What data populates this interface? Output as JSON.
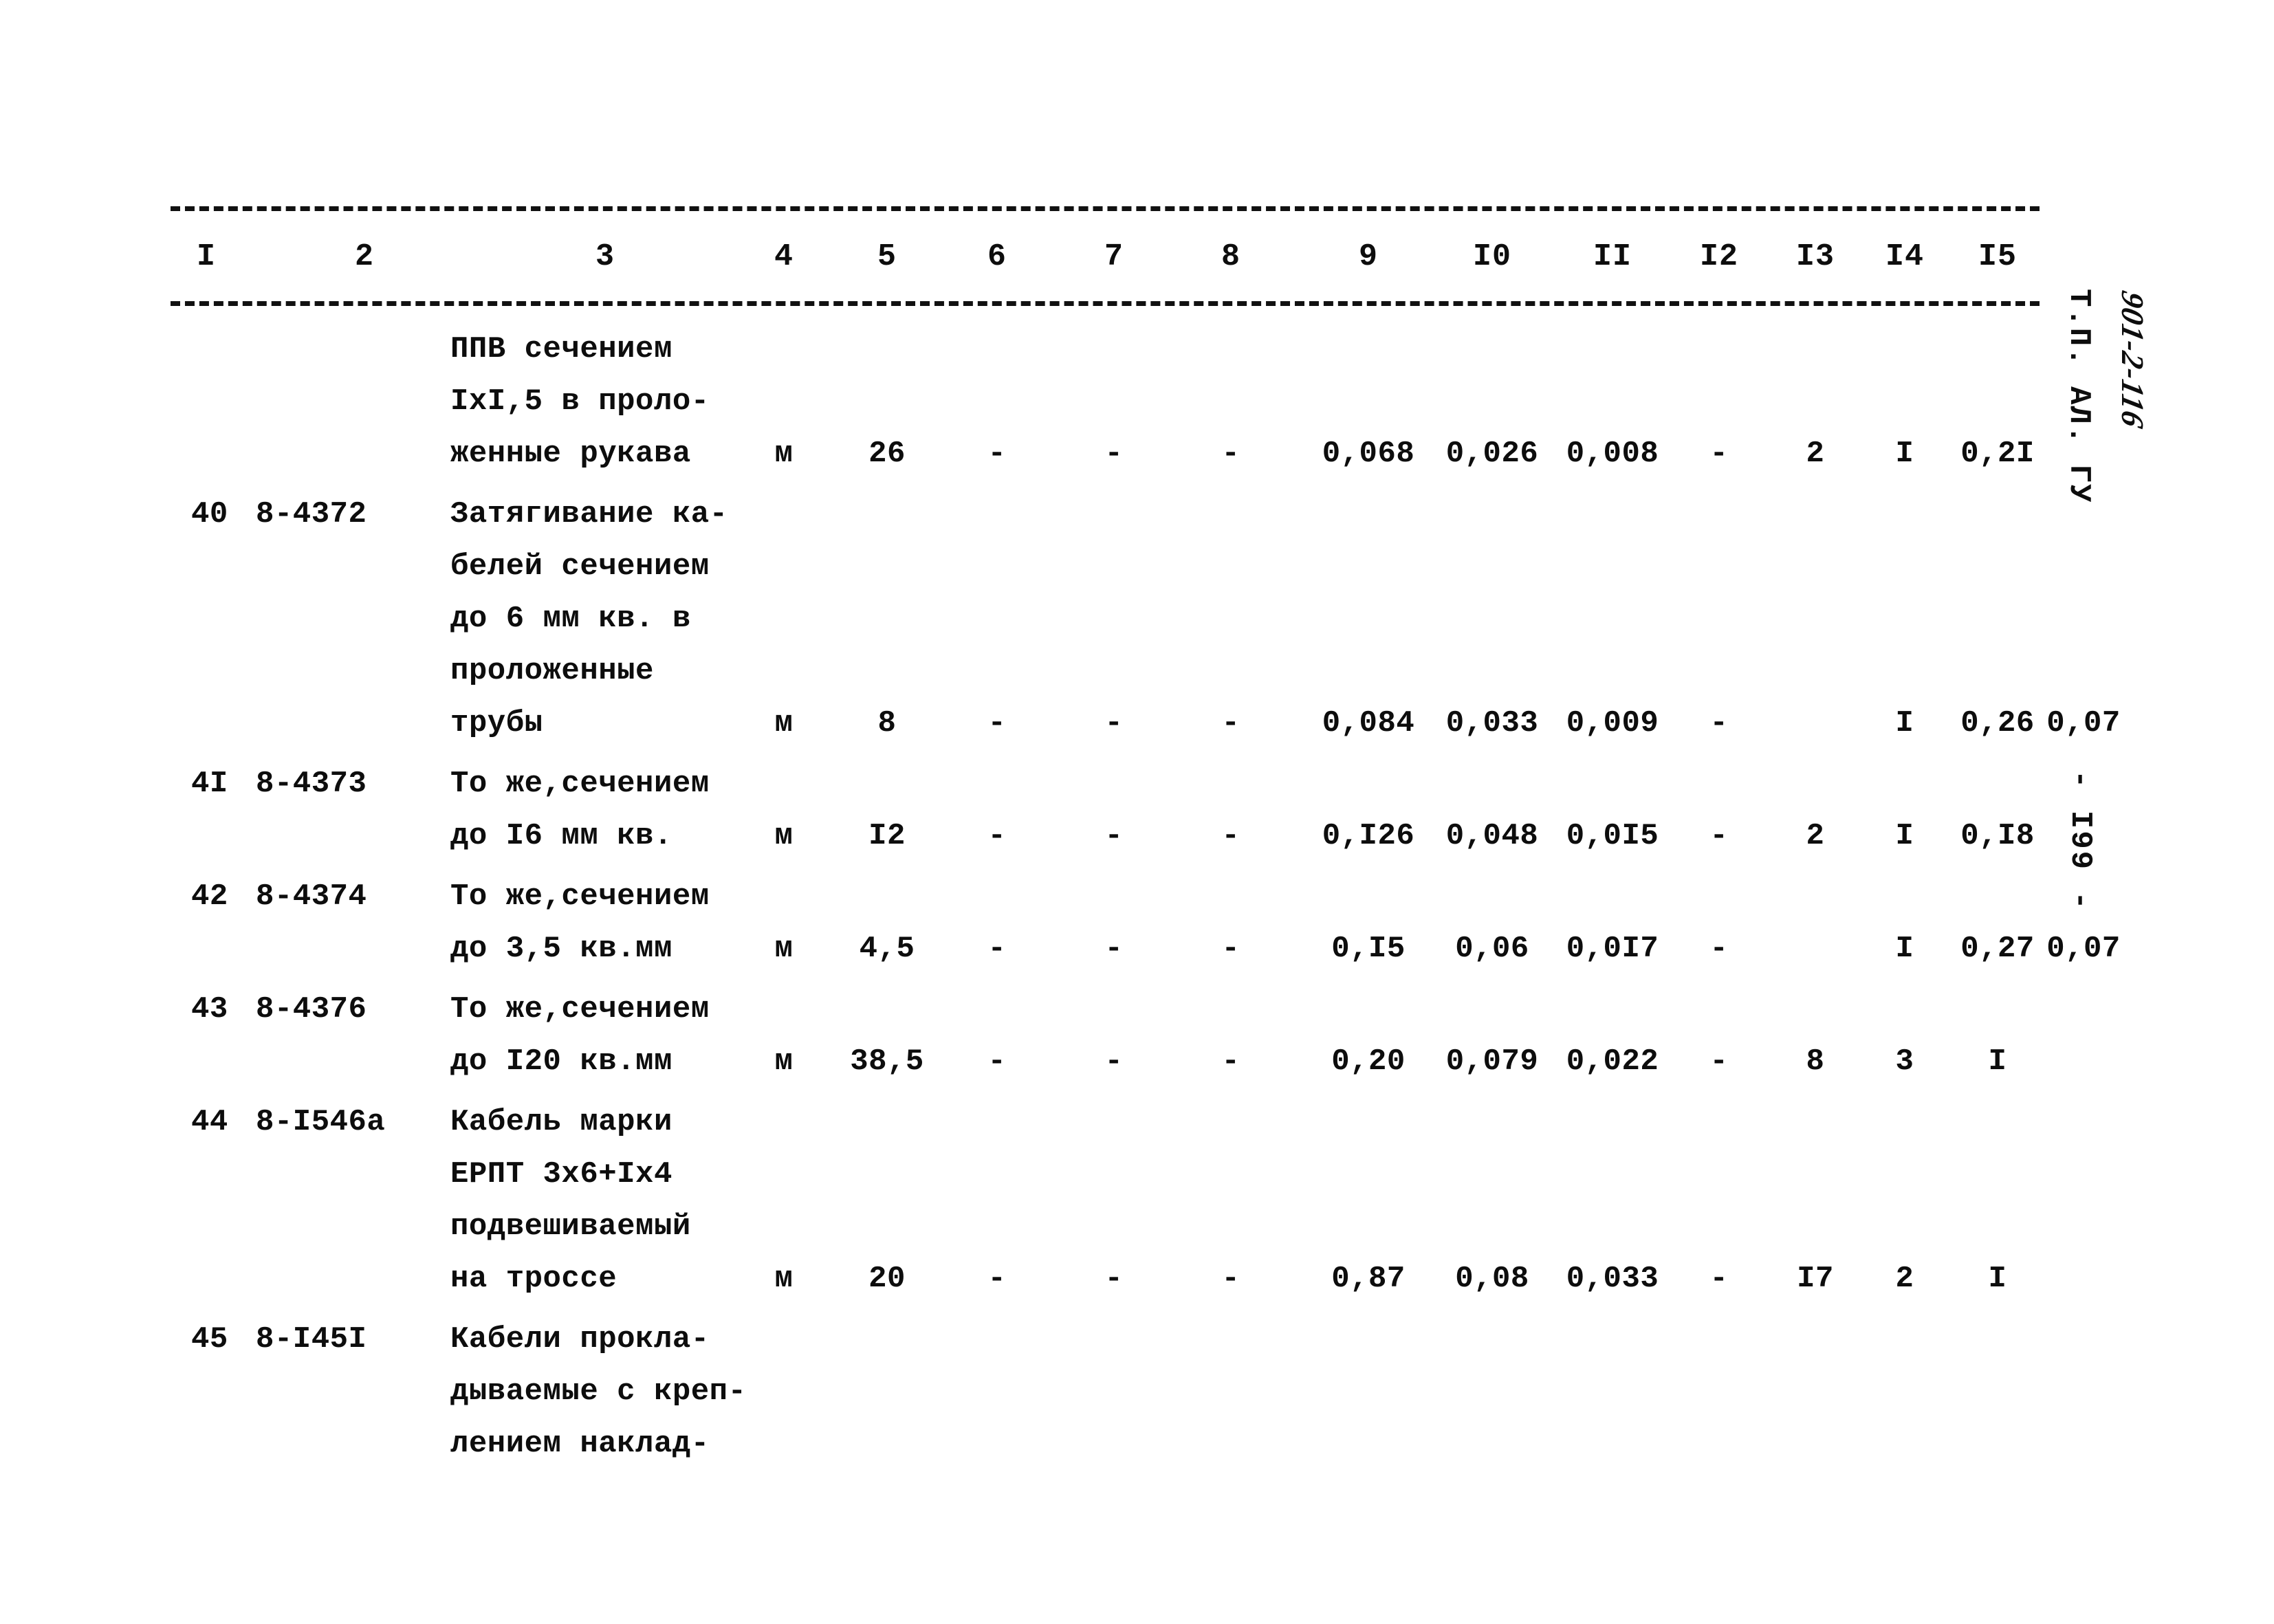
{
  "document": {
    "vertical_stamp": "Т.П. АЛ. ГУ",
    "vertical_code": "901-2-116",
    "page_marker": "- I99 -"
  },
  "table": {
    "column_headers": [
      "I",
      "2",
      "3",
      "4",
      "5",
      "6",
      "7",
      "8",
      "9",
      "I0",
      "II",
      "I2",
      "I3",
      "I4",
      "I5"
    ],
    "rows": [
      {
        "num": "",
        "code": "",
        "desc_lines": [
          "ППВ сечением",
          "IxI,5 в проло-",
          "женные рукава"
        ],
        "value_line_index": 2,
        "unit": "м",
        "qty": "26",
        "c6": "-",
        "c7": "-",
        "c8": "-",
        "c9": "0,068",
        "c10": "0,026",
        "c11": "0,008",
        "c12": "-",
        "c13": "2",
        "c14": "I",
        "c15": "0,2I"
      },
      {
        "num": "40",
        "code": "8-4372",
        "desc_lines": [
          "Затягивание ка-",
          "белей сечением",
          "до 6 мм кв. в",
          "проложенные",
          "трубы"
        ],
        "value_line_index": 4,
        "unit": "м",
        "qty": "8",
        "c6": "-",
        "c7": "-",
        "c8": "-",
        "c9": "0,084",
        "c10": "0,033",
        "c11": "0,009",
        "c12": "-",
        "c13": "",
        "c14": "I",
        "c15": "0,26",
        "c16": "0,07"
      },
      {
        "num": "4I",
        "code": "8-4373",
        "desc_lines": [
          "То же,сечением",
          "до I6 мм кв."
        ],
        "value_line_index": 1,
        "unit": "м",
        "qty": "I2",
        "c6": "-",
        "c7": "-",
        "c8": "-",
        "c9": "0,I26",
        "c10": "0,048",
        "c11": "0,0I5",
        "c12": "-",
        "c13": "2",
        "c14": "I",
        "c15": "0,I8"
      },
      {
        "num": "42",
        "code": "8-4374",
        "desc_lines": [
          "То же,сечением",
          "до 3,5 кв.мм"
        ],
        "value_line_index": 1,
        "unit": "м",
        "qty": "4,5",
        "c6": "-",
        "c7": "-",
        "c8": "-",
        "c9": "0,I5",
        "c10": "0,06",
        "c11": "0,0I7",
        "c12": "-",
        "c13": "",
        "c14": "I",
        "c15": "0,27",
        "c16": "0,07"
      },
      {
        "num": "43",
        "code": "8-4376",
        "desc_lines": [
          "То же,сечением",
          "до I20 кв.мм"
        ],
        "value_line_index": 1,
        "unit": "м",
        "qty": "38,5",
        "c6": "-",
        "c7": "-",
        "c8": "-",
        "c9": "0,20",
        "c10": "0,079",
        "c11": "0,022",
        "c12": "-",
        "c13": "8",
        "c14": "3",
        "c15": "I"
      },
      {
        "num": "44",
        "code": "8-I546а",
        "desc_lines": [
          "Кабель марки",
          "ЕРПТ 3x6+Ix4",
          "подвешиваемый",
          "на троссе"
        ],
        "value_line_index": 3,
        "unit": "м",
        "qty": "20",
        "c6": "-",
        "c7": "-",
        "c8": "-",
        "c9": "0,87",
        "c10": "0,08",
        "c11": "0,033",
        "c12": "-",
        "c13": "I7",
        "c14": "2",
        "c15": "I"
      },
      {
        "num": "45",
        "code": "8-I45I",
        "desc_lines": [
          "Кабели прокла-",
          "дываемые с креп-",
          "лением наклад-"
        ],
        "value_line_index": -1,
        "unit": "",
        "qty": "",
        "c6": "",
        "c7": "",
        "c8": "",
        "c9": "",
        "c10": "",
        "c11": "",
        "c12": "",
        "c13": "",
        "c14": "",
        "c15": ""
      }
    ]
  }
}
